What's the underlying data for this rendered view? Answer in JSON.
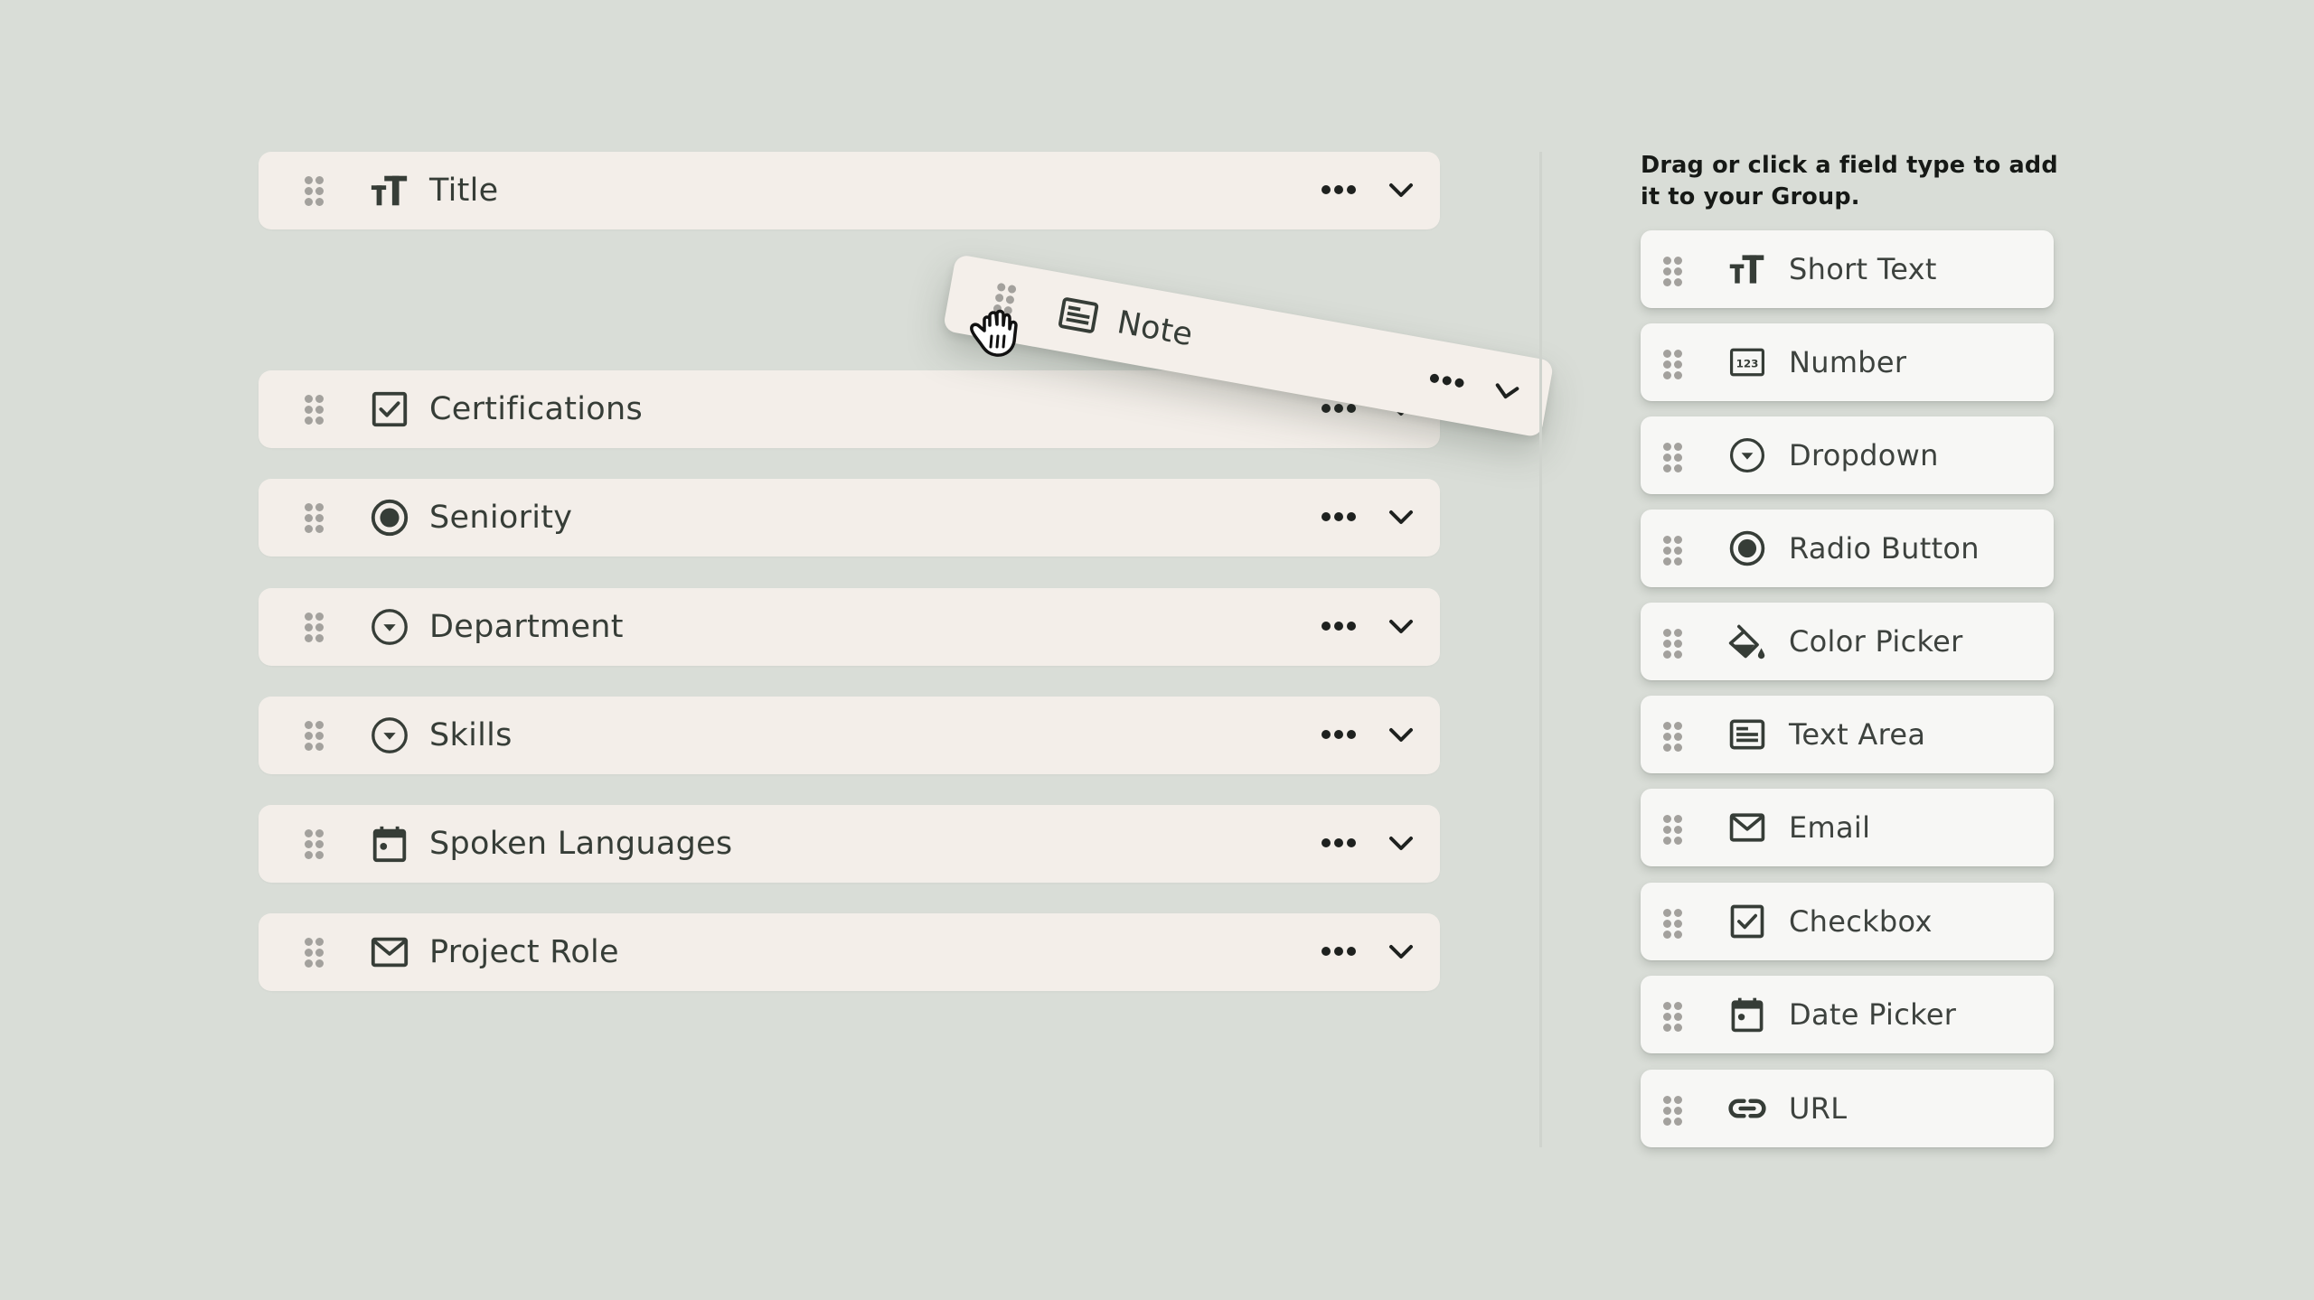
{
  "group_fields": [
    {
      "label": "Title",
      "icon": "short-text-icon"
    },
    {
      "label": "Certifications",
      "icon": "checkbox-icon"
    },
    {
      "label": "Seniority",
      "icon": "radio-button-icon"
    },
    {
      "label": "Department",
      "icon": "dropdown-icon"
    },
    {
      "label": "Skills",
      "icon": "dropdown-icon"
    },
    {
      "label": "Spoken Languages",
      "icon": "date-picker-icon"
    },
    {
      "label": "Project Role",
      "icon": "email-icon"
    }
  ],
  "dragging_field": {
    "label": "Note",
    "icon": "text-area-icon"
  },
  "palette": {
    "heading": "Drag or click a field type to add it to your Group.",
    "field_types": [
      {
        "label": "Short Text",
        "icon": "short-text-icon"
      },
      {
        "label": "Number",
        "icon": "number-icon"
      },
      {
        "label": "Dropdown",
        "icon": "dropdown-icon"
      },
      {
        "label": "Radio Button",
        "icon": "radio-button-icon"
      },
      {
        "label": "Color Picker",
        "icon": "color-picker-icon"
      },
      {
        "label": "Text Area",
        "icon": "text-area-icon"
      },
      {
        "label": "Email",
        "icon": "email-icon"
      },
      {
        "label": "Checkbox",
        "icon": "checkbox-icon"
      },
      {
        "label": "Date Picker",
        "icon": "date-picker-icon"
      },
      {
        "label": "URL",
        "icon": "url-icon"
      }
    ]
  },
  "icons": {
    "number_icon_text": "123"
  },
  "colors": {
    "background": "#d9ddd7",
    "group_row": "#f3eee9",
    "palette_card": "#f7f7f5",
    "icon": "#363d37",
    "handle_dots": "#a3a19d"
  }
}
